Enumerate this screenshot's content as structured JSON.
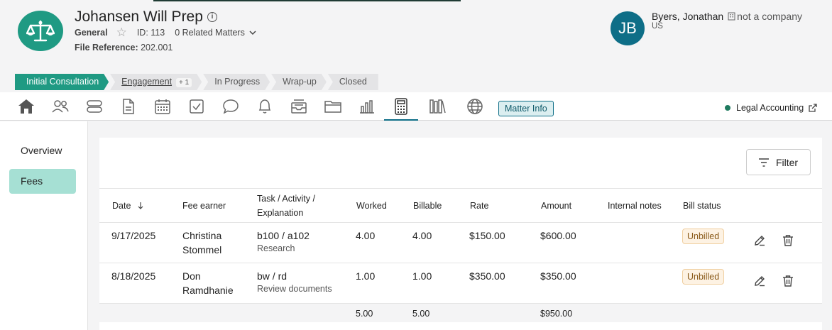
{
  "matter": {
    "title": "Johansen Will Prep",
    "type": "General",
    "id_label": "ID: 113",
    "related": "0 Related Matters",
    "file_ref_label": "File Reference:",
    "file_ref_value": "202.001"
  },
  "client": {
    "initials": "JB",
    "name": "Byers, Jonathan",
    "company": "not a company",
    "country": "US",
    "avatar_color": "#0e6e87"
  },
  "stages": [
    {
      "label": "Initial Consultation"
    },
    {
      "label": "Engagement",
      "badge": "+ 1"
    },
    {
      "label": "In Progress"
    },
    {
      "label": "Wrap-up"
    },
    {
      "label": "Closed"
    }
  ],
  "toolbar": {
    "icons": [
      "home-icon",
      "contacts-icon",
      "stack-icon",
      "document-icon",
      "calendar-icon",
      "checkbox-icon",
      "chat-icon",
      "bell-icon",
      "inbox-icon",
      "folder-icon",
      "bar-chart-icon",
      "calculator-icon",
      "library-icon",
      "globe-icon"
    ],
    "matter_info": "Matter Info",
    "legal_accounting": "Legal Accounting"
  },
  "sidebar": {
    "items": [
      "Overview",
      "Fees"
    ]
  },
  "filter_label": "Filter",
  "table": {
    "headers": {
      "date": "Date",
      "fee_earner": "Fee earner",
      "task_line1": "Task / Activity /",
      "task_line2": "Explanation",
      "worked": "Worked",
      "billable": "Billable",
      "rate": "Rate",
      "amount": "Amount",
      "notes": "Internal notes",
      "status": "Bill status"
    },
    "rows": [
      {
        "date": "9/17/2025",
        "earner_first": "Christina",
        "earner_last": "Stommel",
        "task": "b100 / a102",
        "explanation": "Research",
        "worked": "4.00",
        "billable": "4.00",
        "rate": "$150.00",
        "amount": "$600.00",
        "status": "Unbilled"
      },
      {
        "date": "8/18/2025",
        "earner_first": "Don",
        "earner_last": "Ramdhanie",
        "task": "bw / rd",
        "explanation": "Review documents",
        "worked": "1.00",
        "billable": "1.00",
        "rate": "$350.00",
        "amount": "$350.00",
        "status": "Unbilled"
      }
    ],
    "totals": {
      "worked": "5.00",
      "billable": "5.00",
      "amount": "$950.00"
    }
  }
}
